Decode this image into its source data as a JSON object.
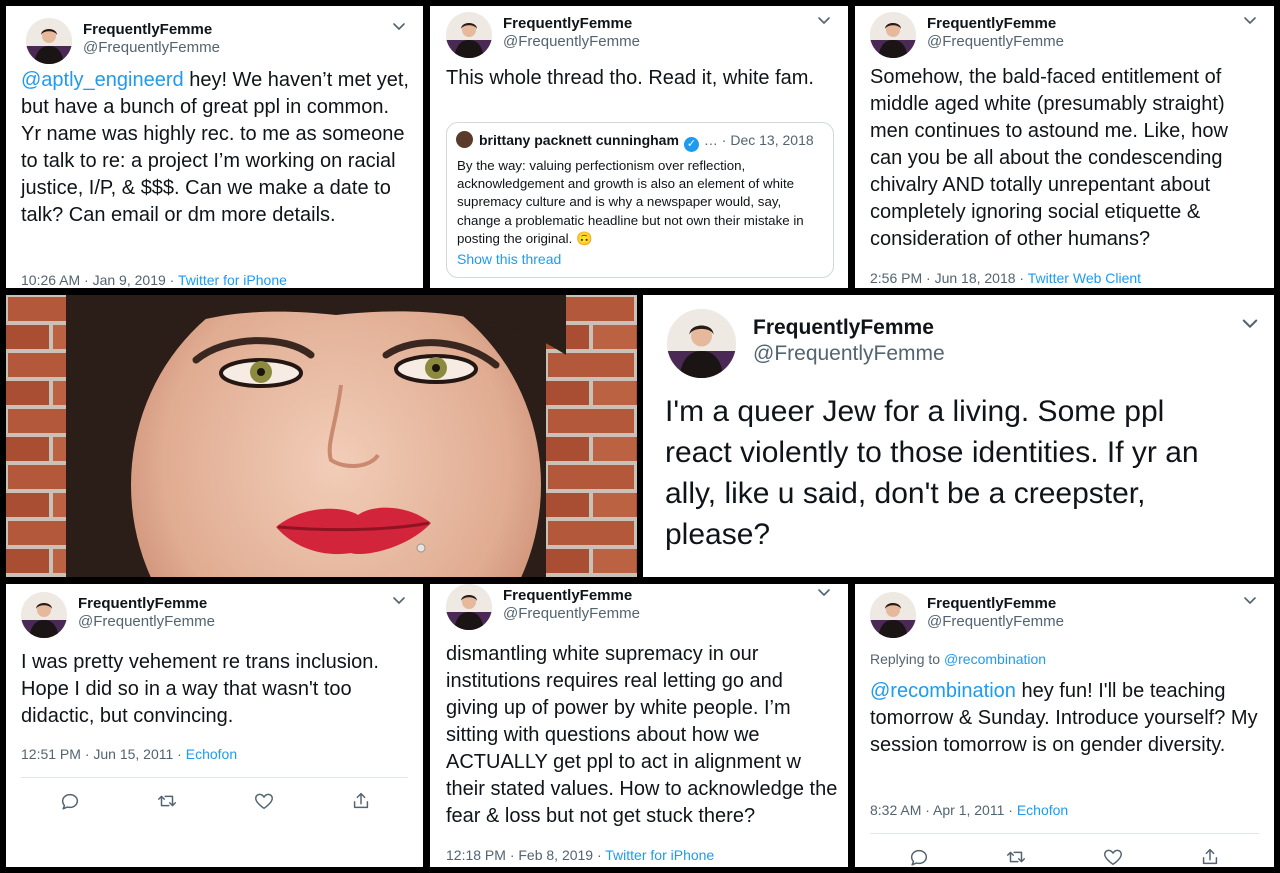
{
  "colors": {
    "link": "#1d9bf0",
    "text": "#0f1419",
    "muted": "#536471"
  },
  "tweets": {
    "t1": {
      "display_name": "FrequentlyFemme",
      "handle": "@FrequentlyFemme",
      "mention": "@aptly_engineerd",
      "text": " hey! We haven’t met yet, but have a bunch of great ppl in common. Yr name was highly rec. to me as someone to talk to re: a project I’m working on racial justice, I/P, & $$$. Can we make a date to talk? Can email or dm more details.",
      "timestamp": "10:26 AM · Jan 9, 2019 · ",
      "source": "Twitter for iPhone"
    },
    "t2": {
      "display_name": "FrequentlyFemme",
      "handle": "@FrequentlyFemme",
      "text": "This whole thread tho. Read it, white fam.",
      "quote": {
        "author": "brittany packnett cunningham",
        "check": "✓",
        "date": "… · Dec 13, 2018",
        "text": "By the way: valuing perfectionism over reflection, acknowledgement and growth is also an element of white supremacy culture and is why a newspaper would, say, change a problematic headline but not own their mistake in posting the original. 🙃",
        "link": "Show this thread"
      }
    },
    "t3": {
      "display_name": "FrequentlyFemme",
      "handle": "@FrequentlyFemme",
      "text": "Somehow, the bald-faced entitlement of middle aged white (presumably straight) men continues to astound me. Like, how can you be all about the condescending chivalry AND totally unrepentant about completely ignoring social etiquette & consideration of other humans?",
      "timestamp": "2:56 PM · Jun 18, 2018 · ",
      "source": "Twitter Web Client"
    },
    "t4": {
      "display_name": "FrequentlyFemme",
      "handle": "@FrequentlyFemme",
      "text": "I'm a queer Jew for a living. Some ppl react violently to those identities. If yr an ally, like u said, don't be a creepster, please?"
    },
    "t5": {
      "display_name": "FrequentlyFemme",
      "handle": "@FrequentlyFemme",
      "text": "I was pretty vehement re trans inclusion. Hope I did so in a way that wasn't too didactic, but convincing.",
      "timestamp": "12:51 PM · Jun 15, 2011 · ",
      "source": "Echofon"
    },
    "t6": {
      "display_name": "FrequentlyFemme",
      "handle": "@FrequentlyFemme",
      "text": "dismantling white supremacy in our institutions requires real letting go and giving up of power by white people. I’m sitting with questions about how we ACTUALLY get ppl to act in alignment w their stated values. How to acknowledge the fear & loss but not get stuck there?",
      "timestamp": "12:18 PM · Feb 8, 2019 · ",
      "source": "Twitter for iPhone"
    },
    "t7": {
      "display_name": "FrequentlyFemme",
      "handle": "@FrequentlyFemme",
      "replying_prefix": "Replying to ",
      "replying_to": "@recombination",
      "mention": "@recombination",
      "text": " hey fun! I'll be teaching tomorrow & Sunday. Introduce yourself? My session tomorrow is on gender diversity.",
      "timestamp": "8:32 AM · Apr 1, 2011 · ",
      "source": "Echofon"
    }
  },
  "icons": [
    "avatar",
    "chevron-down-icon",
    "reply-icon",
    "retweet-icon",
    "like-icon",
    "share-icon",
    "verified-badge-icon"
  ]
}
